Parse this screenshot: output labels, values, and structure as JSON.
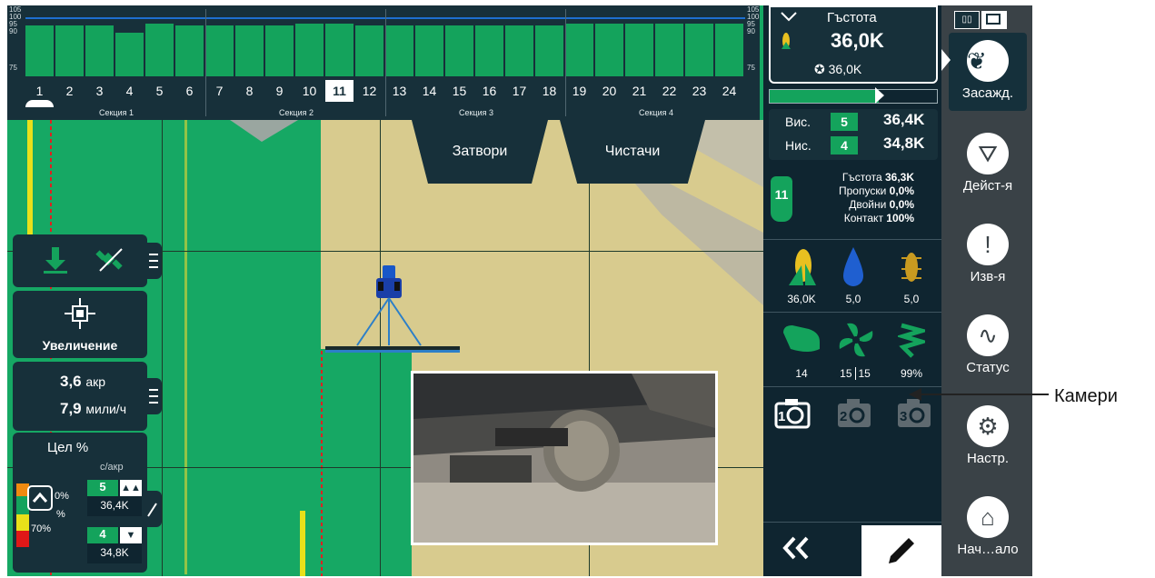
{
  "section_bar": {
    "scale_top": [
      "105",
      "100",
      "95",
      "90"
    ],
    "scale_75": "75",
    "scale_right": [
      "105",
      "100",
      "95",
      "90",
      "75"
    ],
    "rows": [
      "1",
      "2",
      "3",
      "4",
      "5",
      "6",
      "7",
      "8",
      "9",
      "10",
      "11",
      "12",
      "13",
      "14",
      "15",
      "16",
      "17",
      "18",
      "19",
      "20",
      "21",
      "22",
      "23",
      "24"
    ],
    "selected_row": "11",
    "section_labels": [
      "Секция 1",
      "Секция 2",
      "Секция 3",
      "Секция 4"
    ]
  },
  "map_buttons": {
    "shutters": "Затвори",
    "cleaners": "Чистачи"
  },
  "left_panels": {
    "zoom_label": "Увеличение",
    "area_value": "3,6",
    "area_unit": "акр",
    "speed_value": "7,9",
    "speed_unit": "мили/ч",
    "target_title": "Цел %",
    "target_unit": "с/акр",
    "pct_top": "0%",
    "pct_mid": "%",
    "pct_bottom": "70%",
    "high_number": "5",
    "high_value": "36,4K",
    "low_number": "4",
    "low_value": "34,8K"
  },
  "right_panel": {
    "density_title": "Гъстота",
    "density_value": "36,0K",
    "density_target": "36,0K",
    "high_label": "Вис.",
    "high_row": "5",
    "high_value": "36,4K",
    "low_label": "Нис.",
    "low_row": "4",
    "low_value": "34,8K",
    "row_badge": "11",
    "stats": [
      {
        "label": "Гъстота",
        "value": "36,3K"
      },
      {
        "label": "Пропуски",
        "value": "0,0%"
      },
      {
        "label": "Двойни",
        "value": "0,0%"
      },
      {
        "label": "Контакт",
        "value": "100%"
      }
    ],
    "metrics1": [
      "36,0K",
      "5,0",
      "5,0"
    ],
    "metrics2": [
      "14",
      "15",
      "15",
      "99%"
    ],
    "cameras": [
      "1",
      "2",
      "3"
    ]
  },
  "nav": {
    "items": [
      "Засажд.",
      "Дейст-я",
      "Изв-я",
      "Статус",
      "Настр.",
      "Нач…ало"
    ]
  },
  "callout": {
    "label": "Камери"
  },
  "colors": {
    "accent_green": "#14a35c",
    "panel": "#17303a",
    "field_yellow": "#d7c98a"
  }
}
